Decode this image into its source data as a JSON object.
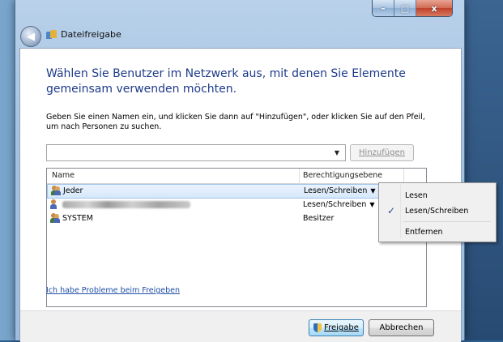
{
  "window": {
    "title": "Dateifreigabe",
    "minimize": "–",
    "maximize": "□",
    "close": "x"
  },
  "heading": "Wählen Sie Benutzer im Netzwerk aus, mit denen Sie Elemente gemeinsam verwenden möchten.",
  "instructions": "Geben Sie einen Namen ein, und klicken Sie dann auf \"Hinzufügen\", oder klicken Sie auf den Pfeil, um nach Personen zu suchen.",
  "name_input": {
    "value": "",
    "arrow": "▼"
  },
  "add_button": {
    "label": "Hinzufügen"
  },
  "table": {
    "columns": [
      "Name",
      "Berechtigungsebene"
    ],
    "rows": [
      {
        "name": "Jeder",
        "permission": "Lesen/Schreiben",
        "has_dropdown": true,
        "selected": true
      },
      {
        "name": "[redacted]",
        "permission": "Lesen/Schreiben",
        "has_dropdown": true,
        "selected": false
      },
      {
        "name": "SYSTEM",
        "permission": "Besitzer",
        "has_dropdown": false,
        "selected": false
      }
    ]
  },
  "context_menu": {
    "items": [
      {
        "label": "Lesen",
        "checked": false
      },
      {
        "label": "Lesen/Schreiben",
        "checked": true
      },
      {
        "label": "Entfernen",
        "checked": false
      }
    ],
    "check_glyph": "✓"
  },
  "help_link": "Ich habe Probleme beim Freigeben",
  "buttons": {
    "share": "Freigabe",
    "cancel": "Abbrechen"
  }
}
